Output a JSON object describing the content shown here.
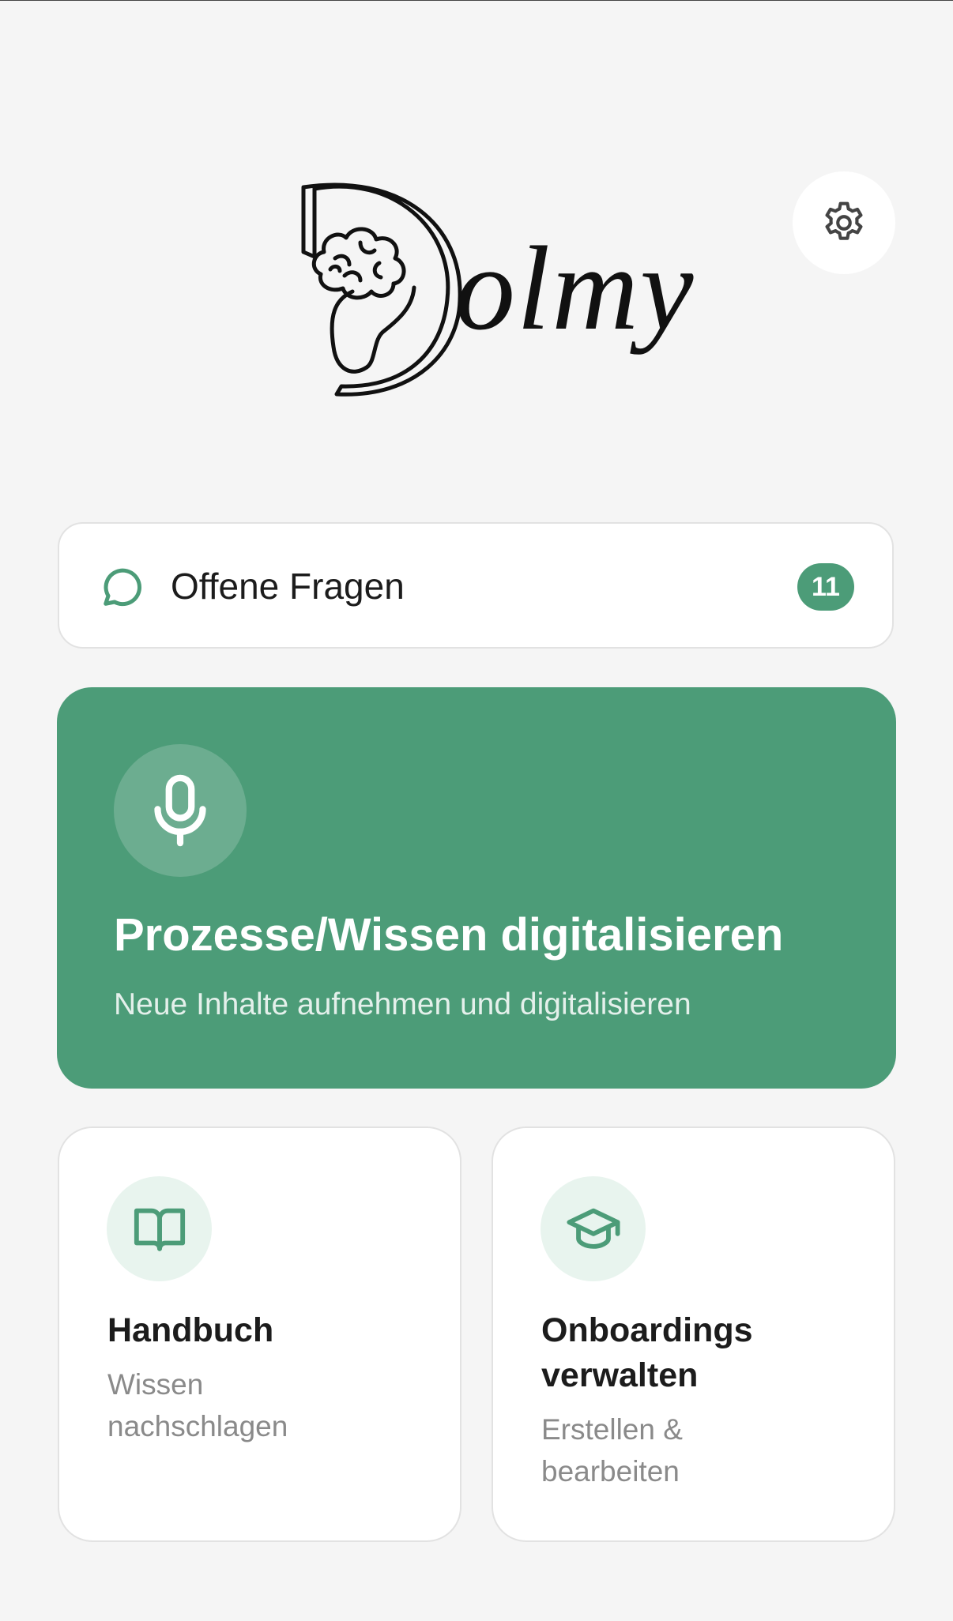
{
  "app": {
    "logo_text": "olmy"
  },
  "questions": {
    "label": "Offene Fragen",
    "count": "11"
  },
  "hero": {
    "title": "Prozesse/Wissen digitalisieren",
    "subtitle": "Neue Inhalte aufnehmen und digitalisieren"
  },
  "tiles": [
    {
      "title": "Handbuch",
      "subtitle": "Wissen nachschlagen",
      "icon": "book-open-icon"
    },
    {
      "title": "Onboardings verwalten",
      "subtitle": "Erstellen & bearbeiten",
      "icon": "graduation-cap-icon"
    }
  ],
  "icons": {
    "settings": "gear-icon",
    "questions": "chat-bubble-icon",
    "hero": "microphone-icon"
  },
  "colors": {
    "accent": "#4c9c78",
    "accent_light": "#e8f4ee",
    "background": "#f5f5f5"
  }
}
